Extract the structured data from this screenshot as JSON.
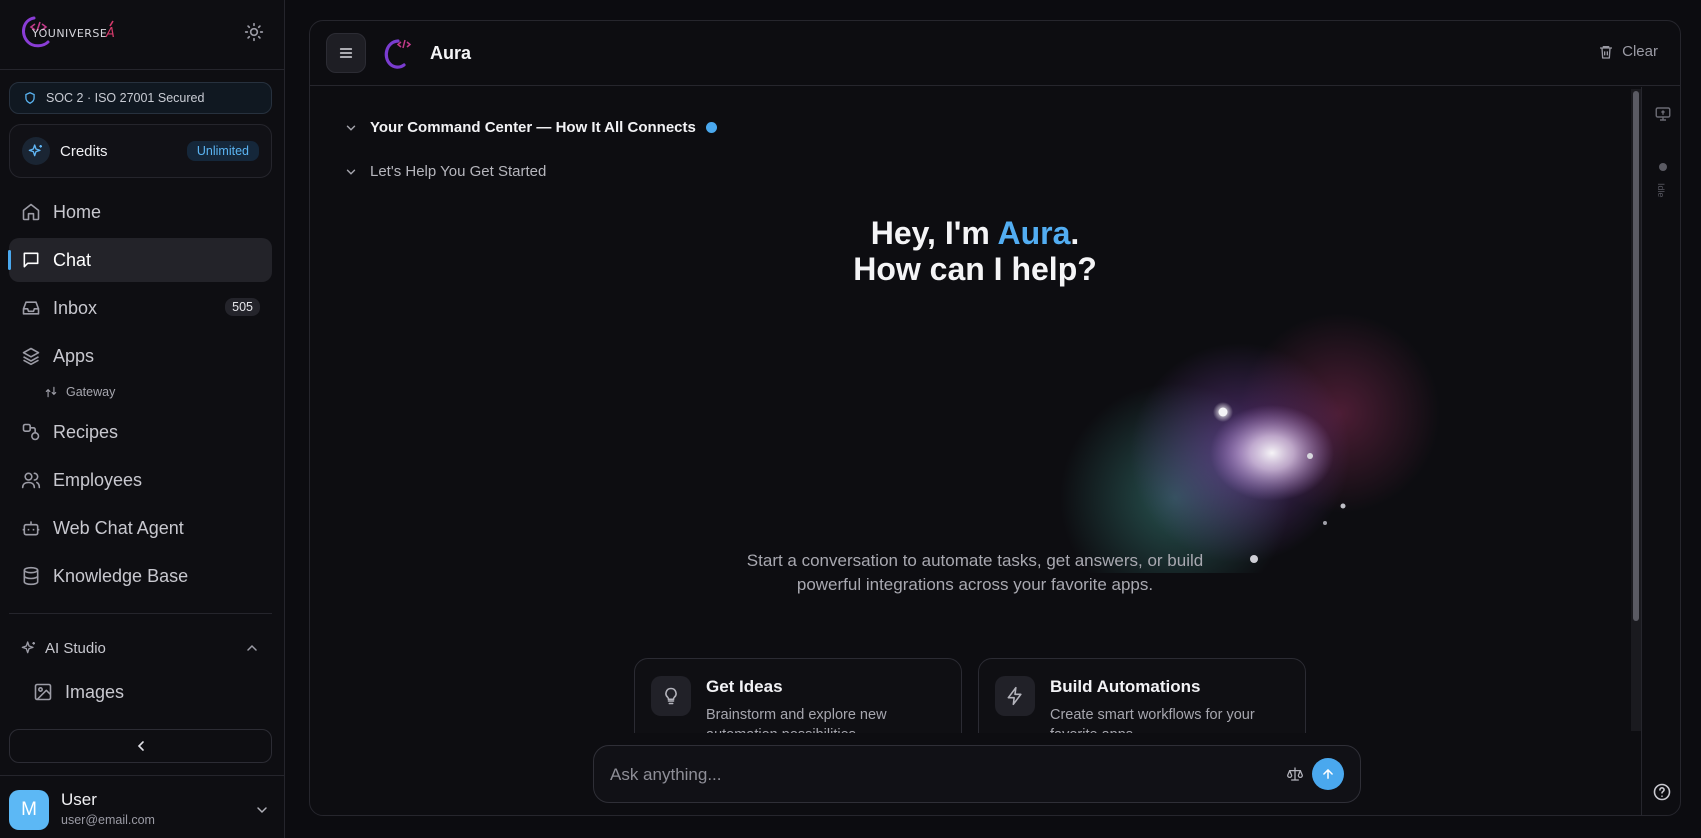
{
  "brand": {
    "logo_text": "YOUNIVERSE AI"
  },
  "security_badge": "SOC 2 · ISO 27001 Secured",
  "credits": {
    "label": "Credits",
    "badge": "Unlimited"
  },
  "nav": {
    "home": "Home",
    "chat": "Chat",
    "inbox": "Inbox",
    "inbox_count": "505",
    "apps": "Apps",
    "gateway": "Gateway",
    "recipes": "Recipes",
    "employees": "Employees",
    "web_chat_agent": "Web Chat Agent",
    "knowledge_base": "Knowledge Base"
  },
  "ai_studio": {
    "label": "AI Studio",
    "images": "Images"
  },
  "user": {
    "initial": "M",
    "name": "User",
    "email": "user@email.com"
  },
  "header": {
    "title": "Aura",
    "clear": "Clear"
  },
  "rail": {
    "status": "Idle"
  },
  "accordions": {
    "command_center": "Your Command Center — How It All Connects",
    "get_started": "Let's Help You Get Started"
  },
  "hero": {
    "line1_prefix": "Hey, I'm ",
    "name": "Aura",
    "line1_suffix": ".",
    "line2": "How can I help?"
  },
  "intro": {
    "line1": "Start a conversation to automate tasks, get answers, or build",
    "line2": "powerful integrations across your favorite apps."
  },
  "cards": [
    {
      "title": "Get Ideas",
      "desc": "Brainstorm and explore new automation possibilities"
    },
    {
      "title": "Build Automations",
      "desc": "Create smart workflows for your favorite apps"
    }
  ],
  "composer": {
    "placeholder": "Ask anything..."
  },
  "colors": {
    "accent": "#4aa8ee",
    "background": "#0c0c10",
    "avatar": "#5cb8f5"
  }
}
